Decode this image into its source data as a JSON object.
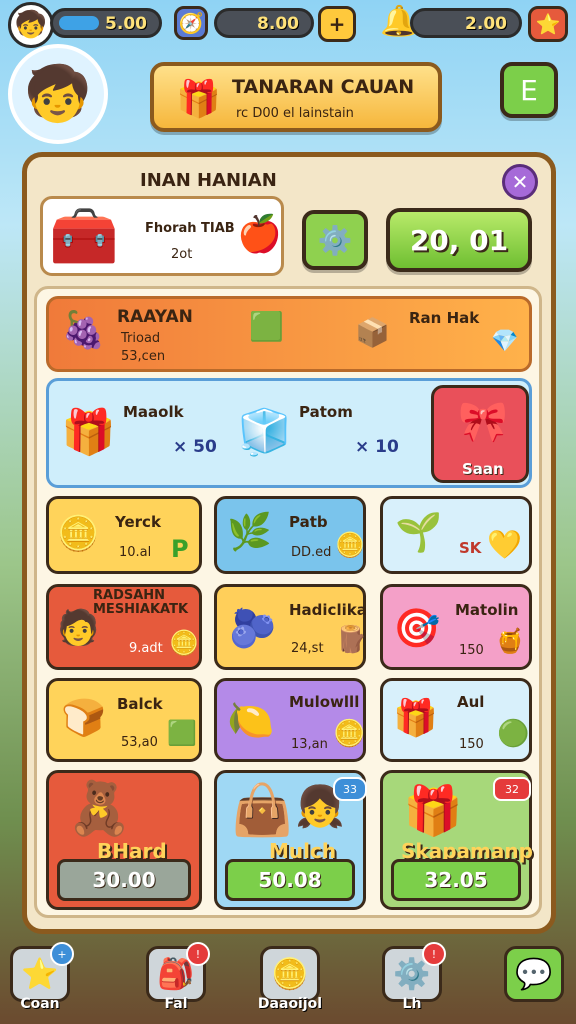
{
  "top_bar": {
    "resource1": "5.00",
    "resource2": "8.00",
    "plus_label": "+",
    "resource3": "2.00"
  },
  "header": {
    "banner_title": "TANARAN CAUAN",
    "banner_sub": "rc D00 el lainstain",
    "menu_label": "E"
  },
  "panel": {
    "title": "INAN HANIAN",
    "info_name": "Fhorah TIAB",
    "info_value": "2ot",
    "score": "20, 01"
  },
  "row1": {
    "title": "RAAYAN",
    "sub1": "Trioad",
    "sub2": "53,cen",
    "right_label": "Ran Hak"
  },
  "row2": {
    "item1_label": "Maaolk",
    "item1_value": "× 50",
    "item2_label": "Patom",
    "item2_value": "× 10",
    "action_label": "Saan"
  },
  "grid": [
    {
      "label": "Yerck",
      "value": "10.al",
      "extra": "P"
    },
    {
      "label": "Patb",
      "value": "DD.ed",
      "extra": ""
    },
    {
      "label": "",
      "value": "SK",
      "extra": ""
    },
    {
      "label": "RADSAHN MESHIAKATK",
      "value": "9.adt",
      "extra": ""
    },
    {
      "label": "Hadiclika",
      "value": "24,st",
      "extra": ""
    },
    {
      "label": "Matolin",
      "value": "150",
      "extra": ""
    },
    {
      "label": "Balck",
      "value": "53,a0",
      "extra": ""
    },
    {
      "label": "Mulowlll",
      "value": "13,an",
      "extra": ""
    },
    {
      "label": "Aul",
      "value": "150",
      "extra": ""
    }
  ],
  "shop": [
    {
      "label": "BHard",
      "price": "30.00"
    },
    {
      "label": "Mulch",
      "price": "50.08",
      "badge": "33"
    },
    {
      "label": "Skapamanp",
      "price": "32.05",
      "badge": "32"
    }
  ],
  "bottom_nav": [
    {
      "label": "Coan"
    },
    {
      "label": "Fal"
    },
    {
      "label": "Daaoijol"
    },
    {
      "label": "Lh"
    },
    {
      "label": ""
    }
  ],
  "colors": {
    "green": "#7ccf4a",
    "orange": "#f28a3c",
    "blue": "#8fd3f4",
    "purple": "#b48ae8",
    "red": "#e65a3c",
    "pink": "#f4a0c8",
    "yellow": "#ffd35a"
  }
}
